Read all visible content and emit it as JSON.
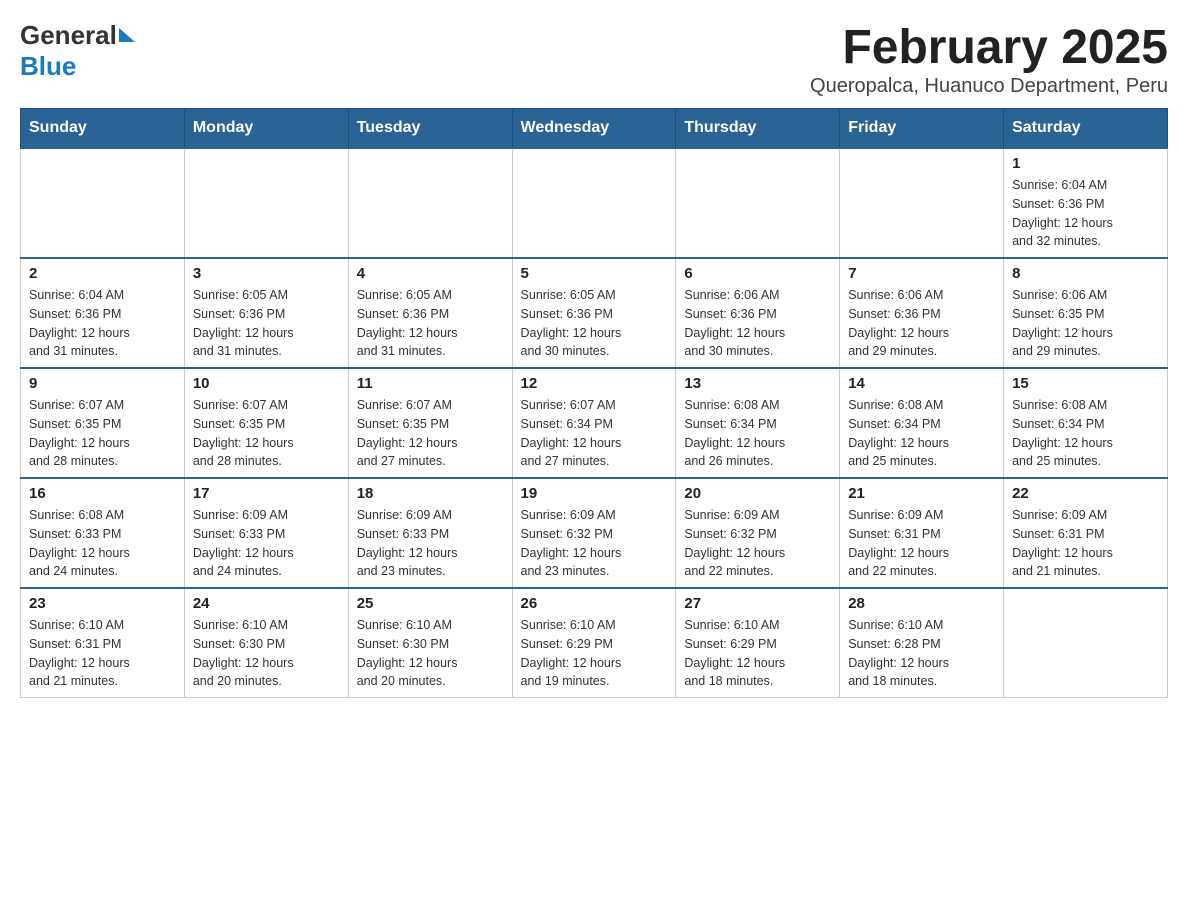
{
  "header": {
    "logo_general": "General",
    "logo_blue": "Blue",
    "title": "February 2025",
    "subtitle": "Queropalca, Huanuco Department, Peru"
  },
  "days_of_week": [
    "Sunday",
    "Monday",
    "Tuesday",
    "Wednesday",
    "Thursday",
    "Friday",
    "Saturday"
  ],
  "weeks": [
    [
      {
        "day": "",
        "info": ""
      },
      {
        "day": "",
        "info": ""
      },
      {
        "day": "",
        "info": ""
      },
      {
        "day": "",
        "info": ""
      },
      {
        "day": "",
        "info": ""
      },
      {
        "day": "",
        "info": ""
      },
      {
        "day": "1",
        "info": "Sunrise: 6:04 AM\nSunset: 6:36 PM\nDaylight: 12 hours\nand 32 minutes."
      }
    ],
    [
      {
        "day": "2",
        "info": "Sunrise: 6:04 AM\nSunset: 6:36 PM\nDaylight: 12 hours\nand 31 minutes."
      },
      {
        "day": "3",
        "info": "Sunrise: 6:05 AM\nSunset: 6:36 PM\nDaylight: 12 hours\nand 31 minutes."
      },
      {
        "day": "4",
        "info": "Sunrise: 6:05 AM\nSunset: 6:36 PM\nDaylight: 12 hours\nand 31 minutes."
      },
      {
        "day": "5",
        "info": "Sunrise: 6:05 AM\nSunset: 6:36 PM\nDaylight: 12 hours\nand 30 minutes."
      },
      {
        "day": "6",
        "info": "Sunrise: 6:06 AM\nSunset: 6:36 PM\nDaylight: 12 hours\nand 30 minutes."
      },
      {
        "day": "7",
        "info": "Sunrise: 6:06 AM\nSunset: 6:36 PM\nDaylight: 12 hours\nand 29 minutes."
      },
      {
        "day": "8",
        "info": "Sunrise: 6:06 AM\nSunset: 6:35 PM\nDaylight: 12 hours\nand 29 minutes."
      }
    ],
    [
      {
        "day": "9",
        "info": "Sunrise: 6:07 AM\nSunset: 6:35 PM\nDaylight: 12 hours\nand 28 minutes."
      },
      {
        "day": "10",
        "info": "Sunrise: 6:07 AM\nSunset: 6:35 PM\nDaylight: 12 hours\nand 28 minutes."
      },
      {
        "day": "11",
        "info": "Sunrise: 6:07 AM\nSunset: 6:35 PM\nDaylight: 12 hours\nand 27 minutes."
      },
      {
        "day": "12",
        "info": "Sunrise: 6:07 AM\nSunset: 6:34 PM\nDaylight: 12 hours\nand 27 minutes."
      },
      {
        "day": "13",
        "info": "Sunrise: 6:08 AM\nSunset: 6:34 PM\nDaylight: 12 hours\nand 26 minutes."
      },
      {
        "day": "14",
        "info": "Sunrise: 6:08 AM\nSunset: 6:34 PM\nDaylight: 12 hours\nand 25 minutes."
      },
      {
        "day": "15",
        "info": "Sunrise: 6:08 AM\nSunset: 6:34 PM\nDaylight: 12 hours\nand 25 minutes."
      }
    ],
    [
      {
        "day": "16",
        "info": "Sunrise: 6:08 AM\nSunset: 6:33 PM\nDaylight: 12 hours\nand 24 minutes."
      },
      {
        "day": "17",
        "info": "Sunrise: 6:09 AM\nSunset: 6:33 PM\nDaylight: 12 hours\nand 24 minutes."
      },
      {
        "day": "18",
        "info": "Sunrise: 6:09 AM\nSunset: 6:33 PM\nDaylight: 12 hours\nand 23 minutes."
      },
      {
        "day": "19",
        "info": "Sunrise: 6:09 AM\nSunset: 6:32 PM\nDaylight: 12 hours\nand 23 minutes."
      },
      {
        "day": "20",
        "info": "Sunrise: 6:09 AM\nSunset: 6:32 PM\nDaylight: 12 hours\nand 22 minutes."
      },
      {
        "day": "21",
        "info": "Sunrise: 6:09 AM\nSunset: 6:31 PM\nDaylight: 12 hours\nand 22 minutes."
      },
      {
        "day": "22",
        "info": "Sunrise: 6:09 AM\nSunset: 6:31 PM\nDaylight: 12 hours\nand 21 minutes."
      }
    ],
    [
      {
        "day": "23",
        "info": "Sunrise: 6:10 AM\nSunset: 6:31 PM\nDaylight: 12 hours\nand 21 minutes."
      },
      {
        "day": "24",
        "info": "Sunrise: 6:10 AM\nSunset: 6:30 PM\nDaylight: 12 hours\nand 20 minutes."
      },
      {
        "day": "25",
        "info": "Sunrise: 6:10 AM\nSunset: 6:30 PM\nDaylight: 12 hours\nand 20 minutes."
      },
      {
        "day": "26",
        "info": "Sunrise: 6:10 AM\nSunset: 6:29 PM\nDaylight: 12 hours\nand 19 minutes."
      },
      {
        "day": "27",
        "info": "Sunrise: 6:10 AM\nSunset: 6:29 PM\nDaylight: 12 hours\nand 18 minutes."
      },
      {
        "day": "28",
        "info": "Sunrise: 6:10 AM\nSunset: 6:28 PM\nDaylight: 12 hours\nand 18 minutes."
      },
      {
        "day": "",
        "info": ""
      }
    ]
  ]
}
